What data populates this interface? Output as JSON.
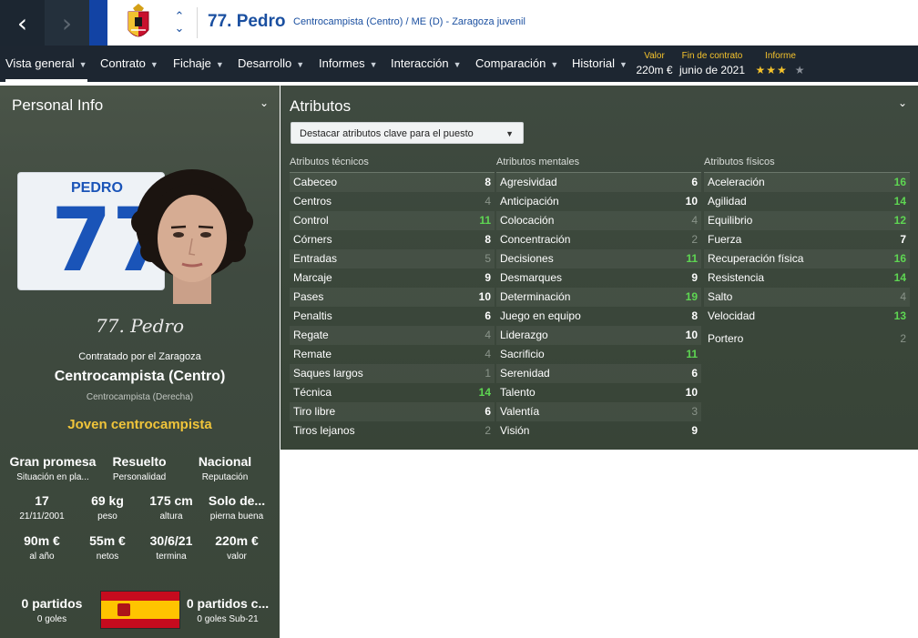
{
  "header": {
    "back_glyph": "‹",
    "forward_glyph": "›",
    "player_title": "77. Pedro",
    "player_desc": "Centrocampista (Centro) / ME (D) - Zaragoza juvenil"
  },
  "menu": [
    {
      "label": "Vista general",
      "active": true
    },
    {
      "label": "Contrato"
    },
    {
      "label": "Fichaje"
    },
    {
      "label": "Desarrollo"
    },
    {
      "label": "Informes"
    },
    {
      "label": "Interacción"
    },
    {
      "label": "Comparación"
    },
    {
      "label": "Historial"
    }
  ],
  "header_stats": {
    "value_label": "Valor",
    "value": "220m €",
    "contract_label": "Fin de contrato",
    "contract": "junio de 2021",
    "report_label": "Informe",
    "report_stars_filled": 3,
    "report_stars_total": 4
  },
  "personal": {
    "title": "Personal Info",
    "shirt_name": "PEDRO",
    "shirt_number": "77",
    "signature": "77. Pedro",
    "signed_by": "Contratado por el Zaragoza",
    "position": "Centrocampista (Centro)",
    "secondary_position": "Centrocampista (Derecha)",
    "role": "Joven centrocampista",
    "stats_row1": [
      {
        "value": "Gran promesa",
        "label": "Situación en pla..."
      },
      {
        "value": "Resuelto",
        "label": "Personalidad"
      },
      {
        "value": "Nacional",
        "label": "Reputación"
      }
    ],
    "stats_row2": [
      {
        "value": "17",
        "label": "21/11/2001"
      },
      {
        "value": "69 kg",
        "label": "peso"
      },
      {
        "value": "175 cm",
        "label": "altura"
      },
      {
        "value": "Solo de...",
        "label": "pierna buena"
      }
    ],
    "stats_row3": [
      {
        "value": "90m €",
        "label": "al año"
      },
      {
        "value": "55m €",
        "label": "netos"
      },
      {
        "value": "30/6/21",
        "label": "termina"
      },
      {
        "value": "220m €",
        "label": "valor"
      }
    ],
    "caps": {
      "value": "0 partidos",
      "label": "0 goles"
    },
    "u21_caps": {
      "value": "0 partidos c...",
      "label": "0 goles Sub-21"
    },
    "colors": {
      "flag_red": "#c60b1e",
      "flag_yellow": "#ffc400"
    }
  },
  "attributes": {
    "title": "Atributos",
    "highlight_label": "Destacar atributos clave para el puesto",
    "technical": {
      "heading": "Atributos técnicos",
      "items": [
        {
          "name": "Cabeceo",
          "value": "8"
        },
        {
          "name": "Centros",
          "value": "4"
        },
        {
          "name": "Control",
          "value": "11"
        },
        {
          "name": "Córners",
          "value": "8"
        },
        {
          "name": "Entradas",
          "value": "5"
        },
        {
          "name": "Marcaje",
          "value": "9"
        },
        {
          "name": "Pases",
          "value": "10"
        },
        {
          "name": "Penaltis",
          "value": "6"
        },
        {
          "name": "Regate",
          "value": "4"
        },
        {
          "name": "Remate",
          "value": "4"
        },
        {
          "name": "Saques largos",
          "value": "1"
        },
        {
          "name": "Técnica",
          "value": "14"
        },
        {
          "name": "Tiro libre",
          "value": "6"
        },
        {
          "name": "Tiros lejanos",
          "value": "2"
        }
      ]
    },
    "mental": {
      "heading": "Atributos mentales",
      "items": [
        {
          "name": "Agresividad",
          "value": "6"
        },
        {
          "name": "Anticipación",
          "value": "10"
        },
        {
          "name": "Colocación",
          "value": "4"
        },
        {
          "name": "Concentración",
          "value": "2"
        },
        {
          "name": "Decisiones",
          "value": "11"
        },
        {
          "name": "Desmarques",
          "value": "9"
        },
        {
          "name": "Determinación",
          "value": "19"
        },
        {
          "name": "Juego en equipo",
          "value": "8"
        },
        {
          "name": "Liderazgo",
          "value": "10"
        },
        {
          "name": "Sacrificio",
          "value": "11"
        },
        {
          "name": "Serenidad",
          "value": "6"
        },
        {
          "name": "Talento",
          "value": "10"
        },
        {
          "name": "Valentía",
          "value": "3"
        },
        {
          "name": "Visión",
          "value": "9"
        }
      ]
    },
    "physical": {
      "heading": "Atributos físicos",
      "items": [
        {
          "name": "Aceleración",
          "value": "16"
        },
        {
          "name": "Agilidad",
          "value": "14"
        },
        {
          "name": "Equilibrio",
          "value": "12"
        },
        {
          "name": "Fuerza",
          "value": "7"
        },
        {
          "name": "Recuperación física",
          "value": "16"
        },
        {
          "name": "Resistencia",
          "value": "14"
        },
        {
          "name": "Salto",
          "value": "4"
        },
        {
          "name": "Velocidad",
          "value": "13"
        }
      ],
      "goalkeeper": {
        "name": "Portero",
        "value": "2"
      }
    }
  }
}
